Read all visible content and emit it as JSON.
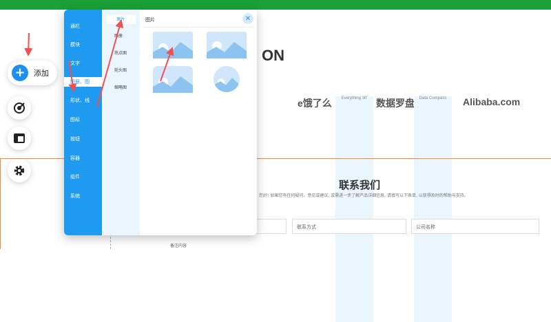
{
  "colors": {
    "topbar": "#1aa037",
    "accent": "#1e9bf0",
    "arrow": "#f05050",
    "section_border": "#f08a3a"
  },
  "dock": {
    "add_label": "添加",
    "icons": [
      "plus-icon",
      "target-icon",
      "layout-icon",
      "gear-icon"
    ]
  },
  "panel": {
    "categories": [
      "通栏",
      "模块",
      "文字",
      "图册、图",
      "形状、线",
      "图标",
      "按钮",
      "容器",
      "组件",
      "系统"
    ],
    "active_category": "图册、图",
    "subcategories": [
      "图片",
      "图册",
      "热点图",
      "轮头图",
      "缩略图"
    ],
    "active_subcategory": "图片",
    "content_title": "图片",
    "close_icon": "close-icon",
    "thumbnails": [
      "image-thumb-1",
      "image-thumb-2",
      "image-thumb-3",
      "image-thumb-circle"
    ]
  },
  "background_page": {
    "title_fragment": "ON",
    "logos": [
      {
        "main": "e饿了么",
        "sub": "Everything 30'"
      },
      {
        "main": "数据罗盘",
        "sub": "Data Compass"
      },
      {
        "main": "Alibaba.com",
        "sub": ""
      }
    ],
    "contact": {
      "title": "联系我们",
      "description": "您好! 如果您有任何疑问、意见或建议, 或需进一步了解产品详细信息, 请填写以下表单, 以获得及时的帮助与支持。",
      "fields": [
        "联系方式",
        "公司名称"
      ],
      "remark_label": "备注内容"
    }
  }
}
